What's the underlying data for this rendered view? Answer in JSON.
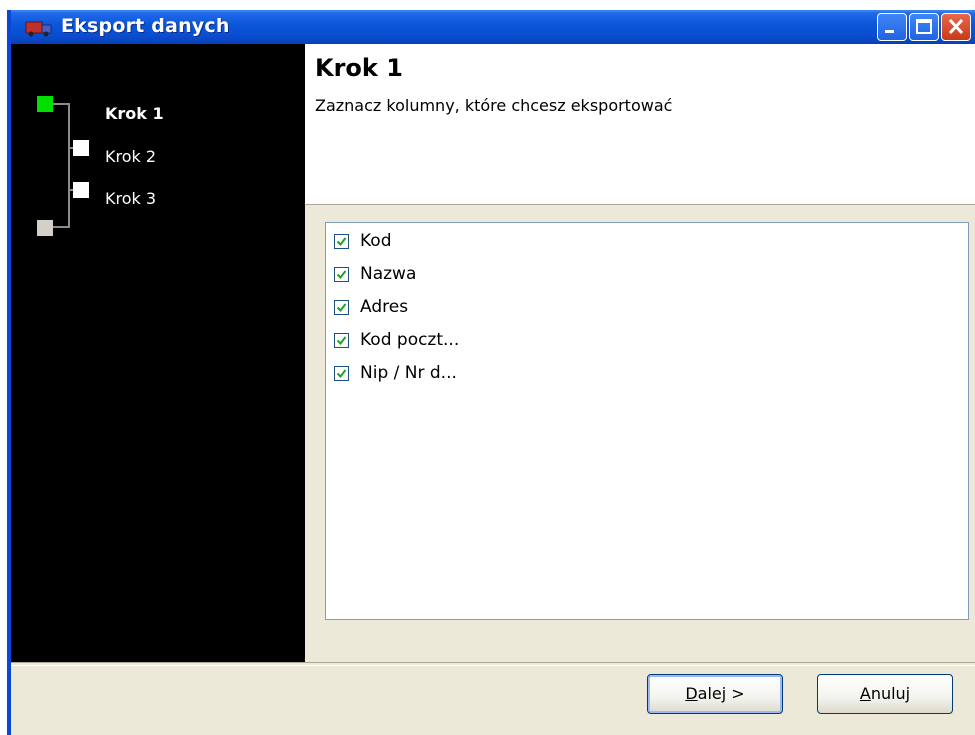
{
  "window": {
    "title": "Eksport danych",
    "icons": {
      "app": "truck-icon",
      "minimize": "minimize-icon",
      "maximize": "maximize-icon",
      "close": "close-icon"
    }
  },
  "steps": [
    {
      "label": "Krok 1",
      "active": true
    },
    {
      "label": "Krok 2",
      "active": false
    },
    {
      "label": "Krok 3",
      "active": false
    }
  ],
  "header": {
    "title": "Krok 1",
    "description": "Zaznacz kolumny, które chcesz eksportować"
  },
  "columns": [
    {
      "label": "Kod",
      "checked": true
    },
    {
      "label": "Nazwa",
      "checked": true
    },
    {
      "label": "Adres",
      "checked": true
    },
    {
      "label": "Kod poczt...",
      "checked": true
    },
    {
      "label": "Nip / Nr d...",
      "checked": true
    }
  ],
  "buttons": {
    "next": {
      "mnemonic": "D",
      "rest": "alej >"
    },
    "cancel": {
      "mnemonic": "A",
      "rest": "nuluj"
    }
  },
  "colors": {
    "titlebar": "#0a55d8",
    "active_step": "#00e000",
    "step_node": "#ffffff",
    "panel": "#000000"
  }
}
